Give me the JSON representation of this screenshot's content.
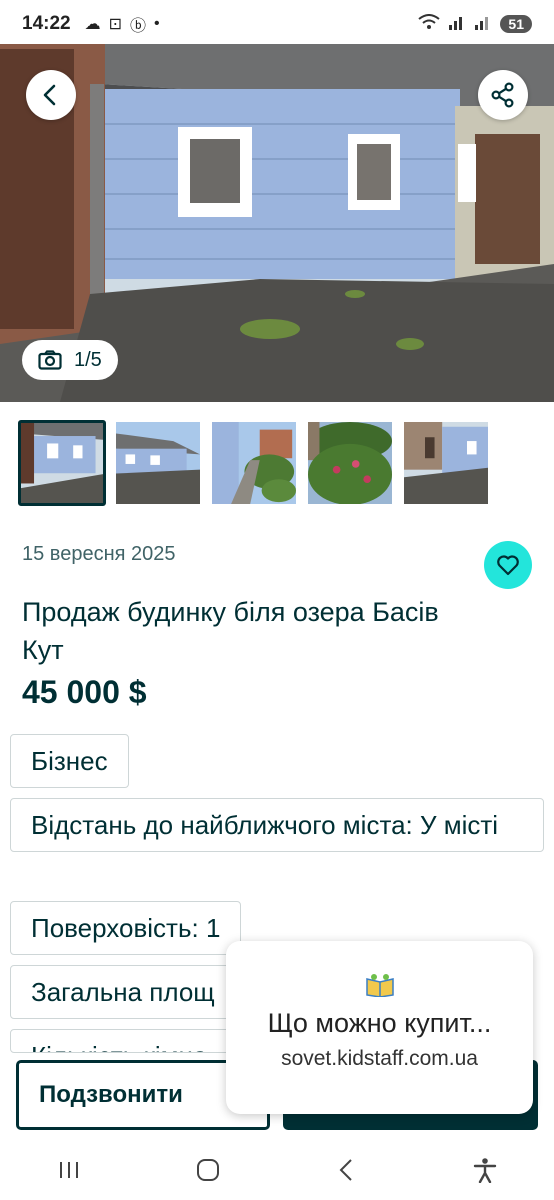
{
  "status_bar": {
    "time": "14:22",
    "battery": "51"
  },
  "gallery": {
    "counter": "1/5",
    "thumb_count": 5
  },
  "listing": {
    "date": "15 вересня 2025",
    "title": "Продаж будинку біля озера Басів Кут",
    "price": "45 000 $"
  },
  "params": {
    "business": "Бізнес",
    "distance": "Відстань до найближчого міста: У місті",
    "floors": "Поверховість: 1",
    "area": "Загальна площ",
    "rooms": "Кількість кімна"
  },
  "actions": {
    "call_label": "Подзвонити"
  },
  "ad": {
    "title": "Що можно купит...",
    "url": "sovet.kidstaff.com.ua"
  },
  "icons": {
    "back": "chevron-left-icon",
    "share": "share-icon",
    "camera": "camera-icon",
    "favorite": "heart-icon"
  },
  "colors": {
    "accent": "#23e5db",
    "primary": "#002f34",
    "date": "#406367"
  }
}
